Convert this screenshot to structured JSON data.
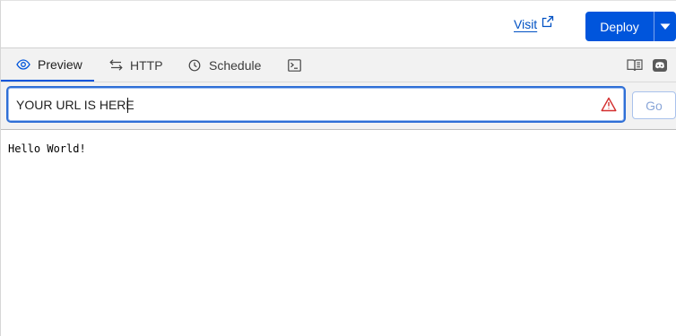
{
  "header": {
    "visit_label": "Visit",
    "deploy_label": "Deploy",
    "accent_color": "#0055dc"
  },
  "tabs": [
    {
      "label": "Preview",
      "icon": "eye-icon",
      "active": true
    },
    {
      "label": "HTTP",
      "icon": "swap-arrows-icon",
      "active": false
    },
    {
      "label": "Schedule",
      "icon": "clock-icon",
      "active": false
    },
    {
      "label": "",
      "icon": "terminal-icon",
      "active": false
    }
  ],
  "toolbar_icons": [
    "docs-book-icon",
    "discord-icon"
  ],
  "url_bar": {
    "value": "YOUR URL IS HERE",
    "status_icon": "warning-icon",
    "status_color": "#d32f2f",
    "go_label": "Go"
  },
  "preview": {
    "output_text": "Hello World!"
  }
}
